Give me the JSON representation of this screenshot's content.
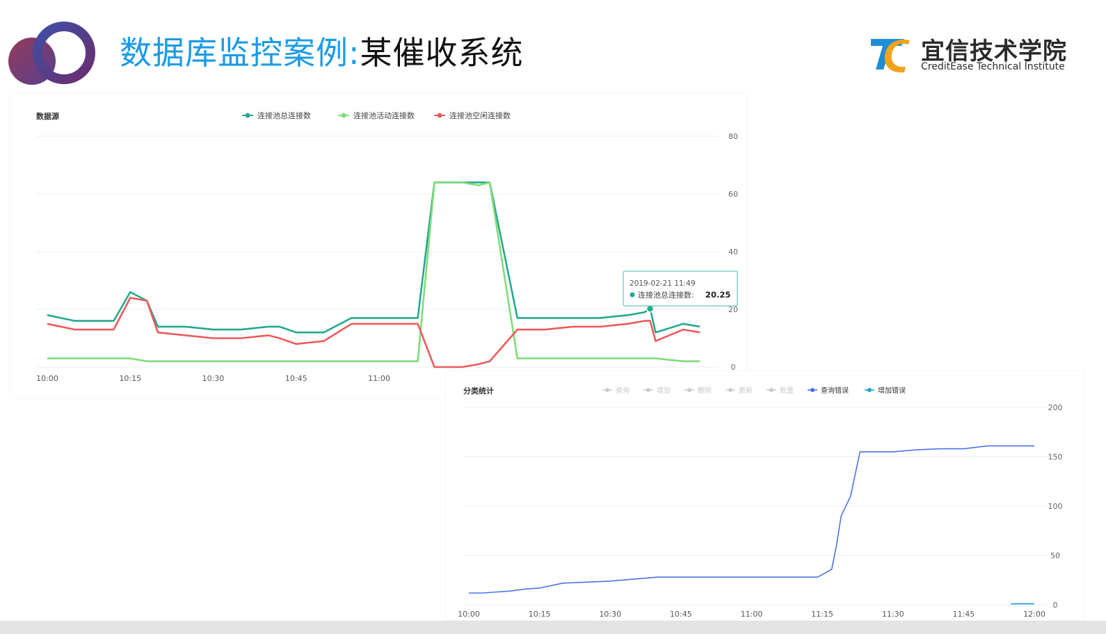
{
  "slide": {
    "title_colored": "数据库监控案例:",
    "title_dark": "某催收系统",
    "brand_cn": "宜信技术学院",
    "brand_en": "CreditEase Technical Institute",
    "colors": {
      "title_blue": "#1a9be6",
      "brand_blue": "#1f8dd6",
      "brand_orange": "#f2a21b",
      "ring_dark": "#5a2a73",
      "ring_light": "#3c4fa8"
    }
  },
  "chart_data": [
    {
      "type": "line",
      "title": "数据源",
      "ylim": [
        0,
        80
      ],
      "y_ticks": [
        "80",
        "60",
        "40",
        "20",
        "0"
      ],
      "x_ticks": [
        "10:00",
        "10:15",
        "10:30",
        "10:45",
        "11:00"
      ],
      "grid": true,
      "legend_position": "top-center",
      "tooltip": {
        "time": "2019-02-21 11:49",
        "series": "连接池总连接数",
        "value": "20.25"
      },
      "x": [
        "10:00",
        "10:05",
        "10:10",
        "10:12",
        "10:15",
        "10:18",
        "10:20",
        "10:25",
        "10:30",
        "10:35",
        "10:40",
        "10:42",
        "10:45",
        "10:50",
        "10:55",
        "11:00",
        "11:05",
        "11:07",
        "11:10",
        "11:15",
        "11:18",
        "11:20",
        "11:25",
        "11:30",
        "11:35",
        "11:40",
        "11:45",
        "11:48",
        "11:49",
        "11:50",
        "11:55",
        "11:58"
      ],
      "series": [
        {
          "name": "连接池总连接数",
          "color": "#23a98f",
          "values": [
            18,
            16,
            16,
            16,
            26,
            23,
            14,
            14,
            13,
            13,
            14,
            14,
            12,
            12,
            17,
            17,
            17,
            17,
            64,
            64,
            64,
            64,
            17,
            17,
            17,
            17,
            18,
            19,
            20.25,
            12,
            15,
            14
          ]
        },
        {
          "name": "连接池活动连接数",
          "color": "#7fdc78",
          "values": [
            3,
            3,
            3,
            3,
            3,
            2,
            2,
            2,
            2,
            2,
            2,
            2,
            2,
            2,
            2,
            2,
            2,
            2,
            64,
            64,
            63,
            64,
            3,
            3,
            3,
            3,
            3,
            3,
            3,
            3,
            2,
            2
          ]
        },
        {
          "name": "连接池空闲连接数",
          "color": "#ee5a5a",
          "values": [
            15,
            13,
            13,
            13,
            24,
            23,
            12,
            11,
            10,
            10,
            11,
            10,
            8,
            9,
            15,
            15,
            15,
            15,
            0,
            0,
            1,
            2,
            13,
            13,
            14,
            14,
            15,
            16,
            16,
            9,
            13,
            12
          ]
        }
      ]
    },
    {
      "type": "line",
      "title": "分类统计",
      "ylim": [
        0,
        200
      ],
      "y_ticks": [
        "200",
        "150",
        "100",
        "50",
        "0"
      ],
      "x_ticks": [
        "10:00",
        "10:15",
        "10:30",
        "10:45",
        "11:00",
        "11:15",
        "11:30",
        "11:45",
        "12:00"
      ],
      "grid": true,
      "legend_position": "top-center",
      "legend": [
        {
          "name": "查询",
          "active": false,
          "color": "#cccccc"
        },
        {
          "name": "增加",
          "active": false,
          "color": "#cccccc"
        },
        {
          "name": "删除",
          "active": false,
          "color": "#cccccc"
        },
        {
          "name": "更新",
          "active": false,
          "color": "#cccccc"
        },
        {
          "name": "批量",
          "active": false,
          "color": "#cccccc"
        },
        {
          "name": "查询错误",
          "active": true,
          "color": "#4a72e8"
        },
        {
          "name": "增加错误",
          "active": true,
          "color": "#1f9fd9"
        }
      ],
      "x": [
        "10:00",
        "10:03",
        "10:06",
        "10:09",
        "10:12",
        "10:15",
        "10:20",
        "10:30",
        "10:35",
        "10:40",
        "10:50",
        "11:00",
        "11:10",
        "11:14",
        "11:17",
        "11:18",
        "11:19",
        "11:21",
        "11:23",
        "11:30",
        "11:35",
        "11:40",
        "11:45",
        "11:50",
        "12:00"
      ],
      "series": [
        {
          "name": "查询错误",
          "color": "#4a72e8",
          "values": [
            12,
            12,
            13,
            14,
            16,
            17,
            22,
            24,
            26,
            28,
            28,
            28,
            28,
            28,
            36,
            60,
            90,
            110,
            155,
            155,
            157,
            158,
            158,
            161,
            161
          ]
        },
        {
          "name": "增加错误",
          "color": "#1f9fd9",
          "x": [
            "11:55",
            "12:00"
          ],
          "values": [
            1,
            1
          ]
        }
      ]
    }
  ]
}
